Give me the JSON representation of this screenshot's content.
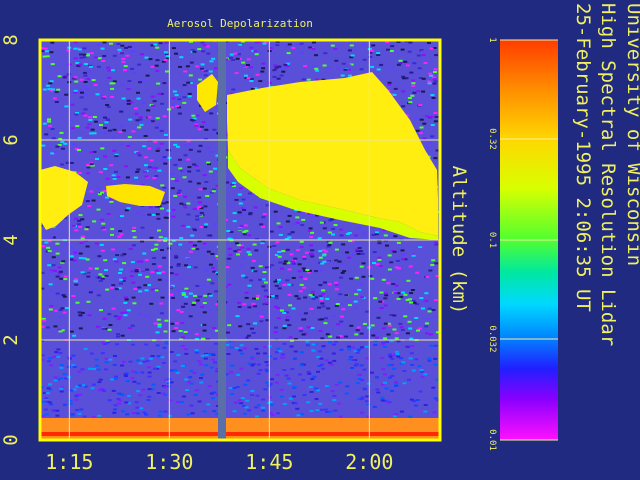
{
  "chart_data": {
    "type": "heatmap",
    "title": "Aerosol Depolarization",
    "ylabel": "Altitude (km)",
    "xlabel": "",
    "y_ticks": [
      "0",
      "2",
      "4",
      "6",
      "8"
    ],
    "x_ticks": [
      "1:15",
      "1:30",
      "1:45",
      "2:00"
    ],
    "ylim": [
      0,
      8
    ],
    "grid": true,
    "colorbar": {
      "scale": "log",
      "range": [
        0.01,
        1
      ],
      "ticks": [
        "1",
        "0.32",
        "0.1",
        "0.032",
        "0.01"
      ]
    },
    "side_text": [
      "University of Wisconsin",
      "High Spectral Resolution Lidar",
      "25-February-1995   2:06:35 UT"
    ]
  },
  "colors": {
    "background": "#1f2a80",
    "label": "#f0f060",
    "frame": "#ffff00",
    "grid": "#e6e6a0",
    "gap": "#5a6ea8"
  }
}
